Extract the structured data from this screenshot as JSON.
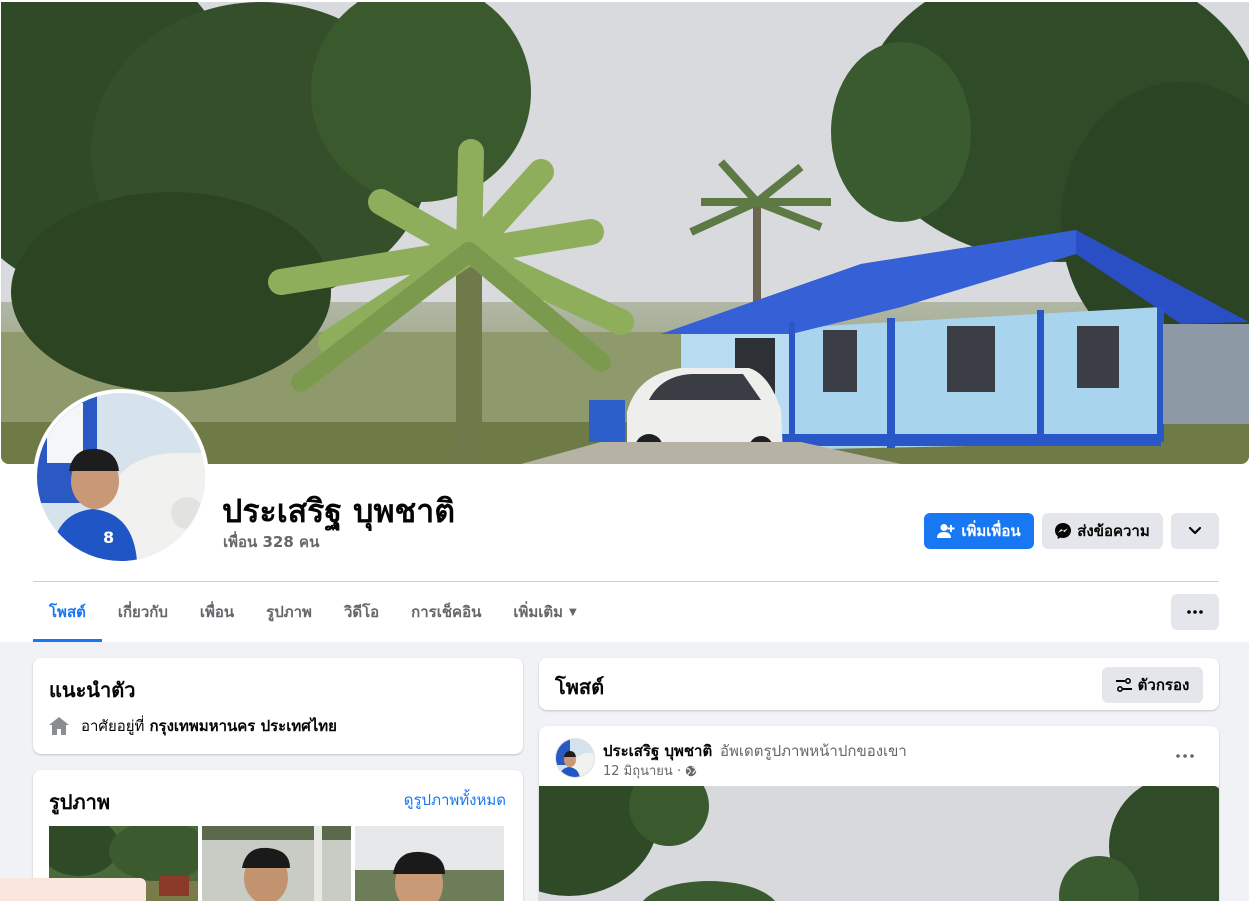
{
  "profile": {
    "name": "ประเสริฐ บุพชาติ",
    "friends_text": "เพื่อน 328 คน"
  },
  "actions": {
    "add_friend_label": "เพิ่มเพื่อน",
    "message_label": "ส่งข้อความ",
    "more_icon": "chevron-down-icon"
  },
  "tabs": [
    {
      "label": "โพสต์",
      "active": true
    },
    {
      "label": "เกี่ยวกับ",
      "active": false
    },
    {
      "label": "เพื่อน",
      "active": false
    },
    {
      "label": "รูปภาพ",
      "active": false
    },
    {
      "label": "วิดีโอ",
      "active": false
    },
    {
      "label": "การเช็คอิน",
      "active": false
    },
    {
      "label": "เพิ่มเติม",
      "active": false
    }
  ],
  "intro": {
    "title": "แนะนำตัว",
    "lives_in_prefix": "อาศัยอยู่ที่",
    "lives_in_place": "กรุงเทพมหานคร ประเทศไทย"
  },
  "photos": {
    "title": "รูปภาพ",
    "see_all_label": "ดูรูปภาพทั้งหมด"
  },
  "posts": {
    "title": "โพสต์",
    "filter_label": "ตัวกรอง"
  },
  "post": {
    "author": "ประเสริฐ บุพชาติ",
    "action": "อัพเดตรูปภาพหน้าปกของเขา",
    "date": "12 มิถุนายน ·",
    "privacy_icon": "globe-icon"
  },
  "colors": {
    "accent": "#1877f2",
    "page_bg": "#f0f2f5",
    "button_gray": "#e4e6eb",
    "secondary_text": "#65676b",
    "roof_blue": "#2a4fc4",
    "wall_blue": "#a9d4ee"
  }
}
